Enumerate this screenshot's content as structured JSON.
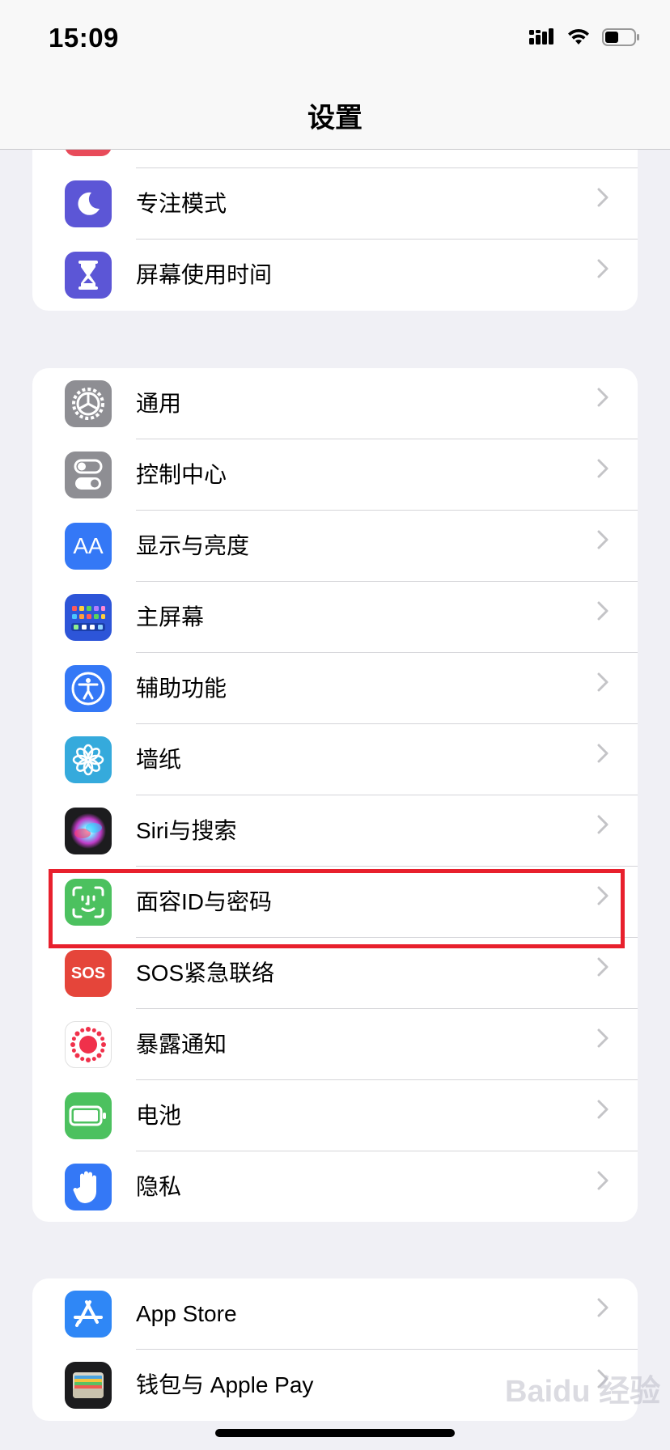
{
  "status_bar": {
    "time": "15:09"
  },
  "header": {
    "title": "设置"
  },
  "group_top": [
    {
      "label": "专注模式",
      "icon": "moon-icon",
      "color": "#5c56d6"
    },
    {
      "label": "屏幕使用时间",
      "icon": "hourglass-icon",
      "color": "#5c56d6"
    }
  ],
  "group_general": [
    {
      "label": "通用",
      "icon": "gear-icon",
      "color": "#8e8e93"
    },
    {
      "label": "控制中心",
      "icon": "toggles-icon",
      "color": "#8e8e93"
    },
    {
      "label": "显示与亮度",
      "icon": "text-size-icon",
      "icon_text": "AA",
      "color": "#3478f6"
    },
    {
      "label": "主屏幕",
      "icon": "home-screen-icon",
      "color": "#2d55d8"
    },
    {
      "label": "辅助功能",
      "icon": "accessibility-icon",
      "color": "#3478f6"
    },
    {
      "label": "墙纸",
      "icon": "flower-icon",
      "color": "#35aadc"
    },
    {
      "label": "Siri与搜索",
      "icon": "siri-icon",
      "color": "#1c1c1e"
    },
    {
      "label": "面容ID与密码",
      "icon": "face-id-icon",
      "color": "#4cc15f"
    },
    {
      "label": "SOS紧急联络",
      "icon": "sos-icon",
      "icon_text": "SOS",
      "color": "#e5453a"
    },
    {
      "label": "暴露通知",
      "icon": "exposure-icon",
      "color": "#ffffff"
    },
    {
      "label": "电池",
      "icon": "battery-icon",
      "color": "#4cc15f"
    },
    {
      "label": "隐私",
      "icon": "hand-icon",
      "color": "#3478f6"
    }
  ],
  "group_store": [
    {
      "label": "App Store",
      "icon": "app-store-icon",
      "color": "#2f87f6"
    },
    {
      "label": "钱包与 Apple Pay",
      "icon": "wallet-icon",
      "color": "#1c1c1e"
    }
  ],
  "highlight_color": "#e8202d",
  "watermark": "Baidu 经验"
}
